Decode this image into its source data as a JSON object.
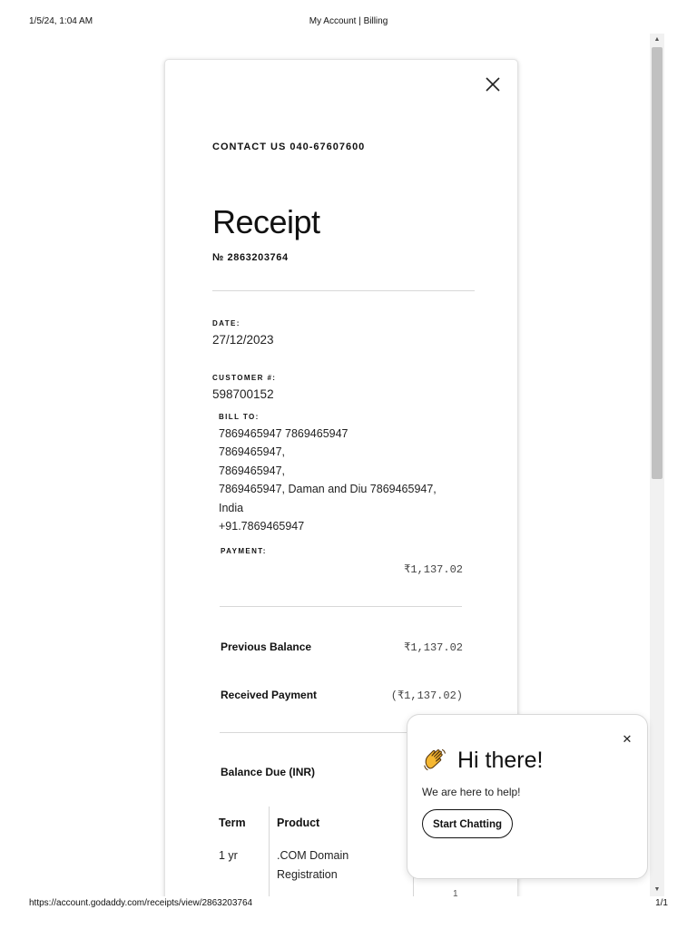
{
  "print_header": {
    "datetime": "1/5/24, 1:04 AM",
    "page_title": "My Account | Billing"
  },
  "print_footer": {
    "url": "https://account.godaddy.com/receipts/view/2863203764",
    "page_count": "1/1"
  },
  "receipt": {
    "contact": "CONTACT US 040-67607600",
    "title": "Receipt",
    "number": "№ 2863203764",
    "date_label": "DATE:",
    "date_value": "27/12/2023",
    "customer_label": "CUSTOMER #:",
    "customer_value": "598700152",
    "bill_to_label": "BILL TO:",
    "bill_to_lines": [
      "7869465947 7869465947",
      "7869465947,",
      "7869465947,",
      "7869465947, Daman and Diu 7869465947,",
      "India",
      "+91.7869465947"
    ],
    "payment_label": "PAYMENT:",
    "payment_amount": "₹1,137.02",
    "previous_balance_label": "Previous Balance",
    "previous_balance_value": "₹1,137.02",
    "received_payment_label": "Received Payment",
    "received_payment_value": "(₹1,137.02)",
    "balance_due_label": "Balance Due (INR)",
    "table": {
      "headers": [
        "Term",
        "Product"
      ],
      "rows": [
        {
          "term": "1 yr",
          "product_line1": ".COM Domain",
          "product_line2": "Registration",
          "qty": "1"
        }
      ]
    }
  },
  "chat": {
    "icon": "waving-hand-icon",
    "greeting": "Hi there!",
    "subtitle": "We are here to help!",
    "button": "Start Chatting"
  },
  "colors": {
    "accent": "#111111",
    "divider": "#d8d8d8",
    "scrollbar_thumb": "#c1c1c1"
  }
}
